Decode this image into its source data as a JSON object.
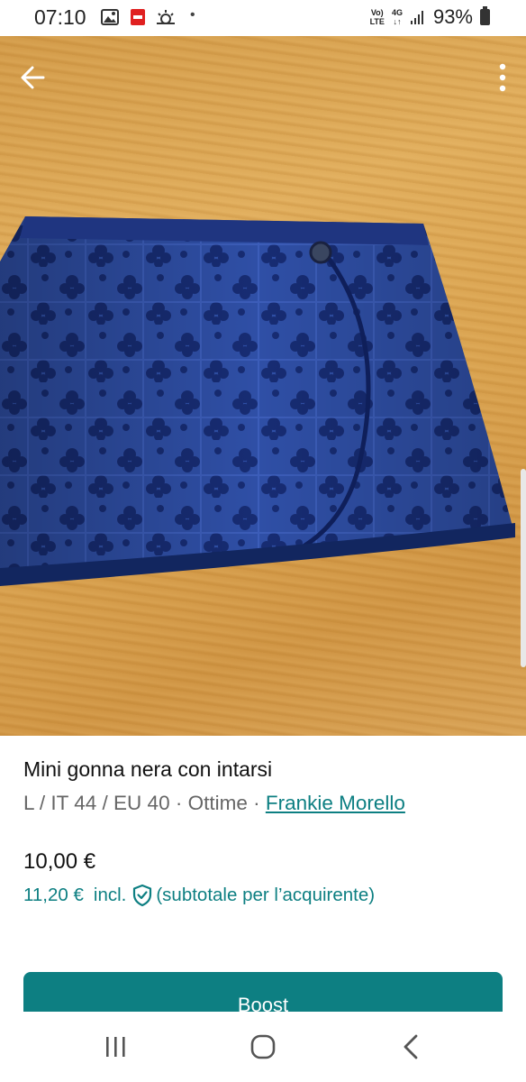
{
  "status_bar": {
    "time": "07:10",
    "network_top": "Vo)",
    "network_bottom": "LTE",
    "gen_top": "4G",
    "battery": "93%",
    "icons": [
      "image-icon",
      "pdf-icon",
      "weather-icon"
    ]
  },
  "photo": {
    "description_icon_left": "back-arrow-icon",
    "description_icon_right": "more-vert-icon"
  },
  "item": {
    "title": "Mini gonna nera con intarsi",
    "meta_prefix": "L / IT 44 / EU 40 · Ottime · ",
    "brand": "Frankie Morello",
    "price": "10,00 €",
    "buyer_price": "11,20 €",
    "buyer_incl": "incl.",
    "buyer_note": "(subtotale per l’acquirente)"
  },
  "actions": {
    "boost_label": "Boost"
  },
  "colors": {
    "accent": "#0d7f82"
  }
}
